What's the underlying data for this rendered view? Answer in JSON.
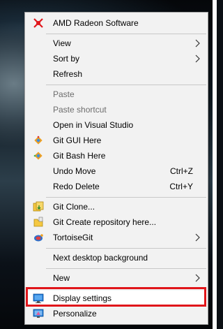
{
  "menu": {
    "amd": {
      "label": "AMD Radeon Software",
      "icon": "amd-radeon-icon",
      "color": "#e0151a"
    },
    "view": {
      "label": "View"
    },
    "sort_by": {
      "label": "Sort by"
    },
    "refresh": {
      "label": "Refresh"
    },
    "paste": {
      "label": "Paste"
    },
    "paste_shortcut": {
      "label": "Paste shortcut"
    },
    "open_vs": {
      "label": "Open in Visual Studio"
    },
    "git_gui": {
      "label": "Git GUI Here",
      "icon": "git-gui-icon"
    },
    "git_bash": {
      "label": "Git Bash Here",
      "icon": "git-bash-icon"
    },
    "undo_move": {
      "label": "Undo Move",
      "shortcut": "Ctrl+Z"
    },
    "redo_delete": {
      "label": "Redo Delete",
      "shortcut": "Ctrl+Y"
    },
    "git_clone": {
      "label": "Git Clone...",
      "icon": "git-clone-icon"
    },
    "git_create": {
      "label": "Git Create repository here...",
      "icon": "git-create-repo-icon"
    },
    "tortoisegit": {
      "label": "TortoiseGit",
      "icon": "tortoisegit-icon"
    },
    "next_bg": {
      "label": "Next desktop background"
    },
    "new": {
      "label": "New"
    },
    "display_settings": {
      "label": "Display settings",
      "icon": "display-settings-icon"
    },
    "personalize": {
      "label": "Personalize",
      "icon": "personalize-icon"
    }
  },
  "highlight_color": "#e0151a"
}
